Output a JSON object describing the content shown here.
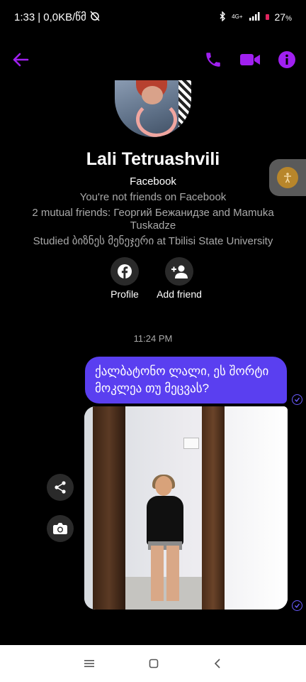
{
  "status_bar": {
    "time": "1:33",
    "network_speed": "| 0,0KB/წმ",
    "network_type": "4G+",
    "battery": "27",
    "battery_unit": "%"
  },
  "header": {
    "back_icon": "back-arrow-icon",
    "call_icon": "phone-icon",
    "video_icon": "video-camera-icon",
    "info_icon": "info-icon",
    "accent_color": "#a020f0"
  },
  "profile": {
    "name": "Lali Tetruashvili",
    "platform": "Facebook",
    "friend_status": "You're not friends on Facebook",
    "mutual_friends": "2 mutual friends: Георгий Бежанидзе and Mamuka Tuskadze",
    "education": "Studied ბიზნეს მენეჯერი at Tbilisi State University",
    "profile_button_label": "Profile",
    "add_friend_button_label": "Add friend"
  },
  "conversation": {
    "timestamp": "11:24 PM",
    "messages": [
      {
        "type": "text",
        "text": "ქალბატონო ლალი, ეს შორტი მოკლეა თუ მეცვას?",
        "bubble_color": "#5a3ff0"
      },
      {
        "type": "photo",
        "description_icon": "mirror-selfie-photo"
      }
    ]
  },
  "nav_bar": {
    "menu_icon": "menu-icon",
    "home_icon": "home-icon",
    "back_icon": "back-icon"
  }
}
